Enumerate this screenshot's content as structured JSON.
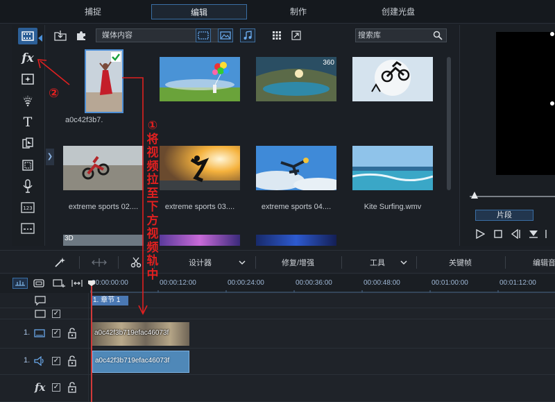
{
  "top_tabs": [
    "捕捉",
    "编辑",
    "制作",
    "创建光盘"
  ],
  "library": {
    "media_dropdown": "媒体内容",
    "search_placeholder": "搜索库",
    "items": [
      {
        "label": "a0c42f3b7."
      },
      {
        "label": ""
      },
      {
        "label": "",
        "badge": "360"
      },
      {
        "label": ""
      },
      {
        "label": "extreme sports 02...."
      },
      {
        "label": "extreme sports 03...."
      },
      {
        "label": "extreme sports 04...."
      },
      {
        "label": "Kite Surfing.wmv"
      },
      {
        "label": "",
        "badge": "3D"
      }
    ]
  },
  "preview": {
    "mode_tab": "片段"
  },
  "edit_toolbar": {
    "designer": "设计器",
    "fix_enhance": "修复/增强",
    "tools": "工具",
    "keyframe": "关键帧",
    "edit_audio": "编辑音"
  },
  "timeline": {
    "ticks": [
      "00:00:00:00",
      "00:00:12:00",
      "00:00:24:00",
      "00:00:36:00",
      "00:00:48:00",
      "00:01:00:00",
      "00:01:12:00"
    ],
    "chapter_label": "1. 章节 1",
    "video_track_number": "1.",
    "audio_track_number": "1.",
    "video_clip": "a0c42f3b719efac46073f",
    "audio_clip": "a0c42f3b719efac46073f"
  },
  "annotations": {
    "step1_num": "①",
    "step1_text": "将视频拉至下方视频轨中",
    "step2": "②"
  },
  "colors": {
    "accent": "#2c5f97",
    "annotation": "#e02020"
  }
}
